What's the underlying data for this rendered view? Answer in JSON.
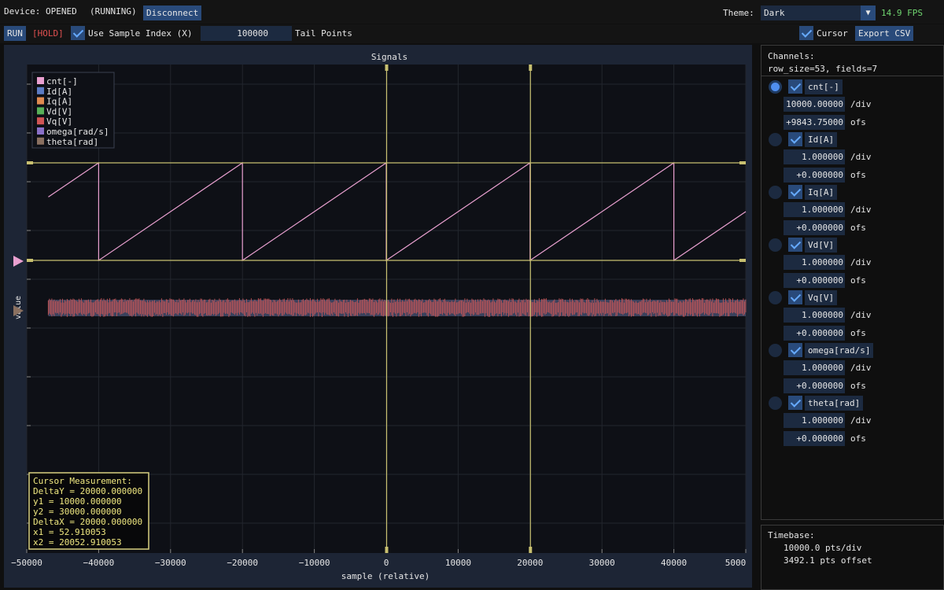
{
  "header": {
    "device_status": "Device: OPENED",
    "run_state": "(RUNNING)",
    "disconnect_label": "Disconnect",
    "theme_label": "Theme:",
    "theme_value": "Dark",
    "fps": "14.9 FPS"
  },
  "toolbar": {
    "run_label": "RUN",
    "hold_label": "[HOLD]",
    "use_sample_index_label": "Use Sample Index (X)",
    "tail_points_value": "100000",
    "tail_points_label": "Tail Points",
    "cursor_label": "Cursor",
    "export_label": "Export CSV"
  },
  "plot": {
    "title": "Signals",
    "xlabel": "sample (relative)",
    "ylabel": "value",
    "xticks": [
      "−50000",
      "−40000",
      "−30000",
      "−20000",
      "−10000",
      "0",
      "10000",
      "20000",
      "30000",
      "40000",
      "5000"
    ],
    "legend": [
      {
        "label": "cnt[-]",
        "color": "#e9a0d0"
      },
      {
        "label": "Id[A]",
        "color": "#5b7bc4"
      },
      {
        "label": "Iq[A]",
        "color": "#e08a50"
      },
      {
        "label": "Vd[V]",
        "color": "#58b058"
      },
      {
        "label": "Vq[V]",
        "color": "#d05555"
      },
      {
        "label": "omega[rad/s]",
        "color": "#8a70c8"
      },
      {
        "label": "theta[rad]",
        "color": "#8a7060"
      }
    ],
    "cursor_box": {
      "title": "Cursor Measurement:",
      "deltay": "DeltaY = 20000.000000",
      "y1": "y1 = 10000.000000",
      "y2": "y2 = 30000.000000",
      "deltax": "DeltaX = 20000.000000",
      "x1": "x1 = 52.910053",
      "x2": "x2 = 20052.910053"
    }
  },
  "chart_data": {
    "type": "line",
    "title": "Signals",
    "xlabel": "sample (relative)",
    "ylabel": "value",
    "xlim": [
      -50000,
      50000
    ],
    "series": [
      {
        "name": "cnt[-]",
        "shape": "sawtooth",
        "period": 20000,
        "min": 10000,
        "max": 30000
      },
      {
        "name": "Vq[V]",
        "shape": "noise",
        "center": 0
      }
    ],
    "cursors": {
      "x1": 52.910053,
      "x2": 20052.910053,
      "y1": 10000,
      "y2": 30000
    }
  },
  "sidebar": {
    "channels_title": "Channels:",
    "row_info": "row_size=53, fields=7",
    "div_unit": "/div",
    "ofs_unit": "ofs",
    "channels": [
      {
        "name": "cnt[-]",
        "scale": "10000.00000",
        "offset": "+9843.75000",
        "selected": true
      },
      {
        "name": "Id[A]",
        "scale": "1.000000",
        "offset": "+0.000000",
        "selected": false
      },
      {
        "name": "Iq[A]",
        "scale": "1.000000",
        "offset": "+0.000000",
        "selected": false
      },
      {
        "name": "Vd[V]",
        "scale": "1.000000",
        "offset": "+0.000000",
        "selected": false
      },
      {
        "name": "Vq[V]",
        "scale": "1.000000",
        "offset": "+0.000000",
        "selected": false
      },
      {
        "name": "omega[rad/s]",
        "scale": "1.000000",
        "offset": "+0.000000",
        "selected": false
      },
      {
        "name": "theta[rad]",
        "scale": "1.000000",
        "offset": "+0.000000",
        "selected": false
      }
    ]
  },
  "timebase": {
    "title": "Timebase:",
    "pts_div": "10000.0 pts/div",
    "pts_offset": "3492.1 pts offset"
  }
}
